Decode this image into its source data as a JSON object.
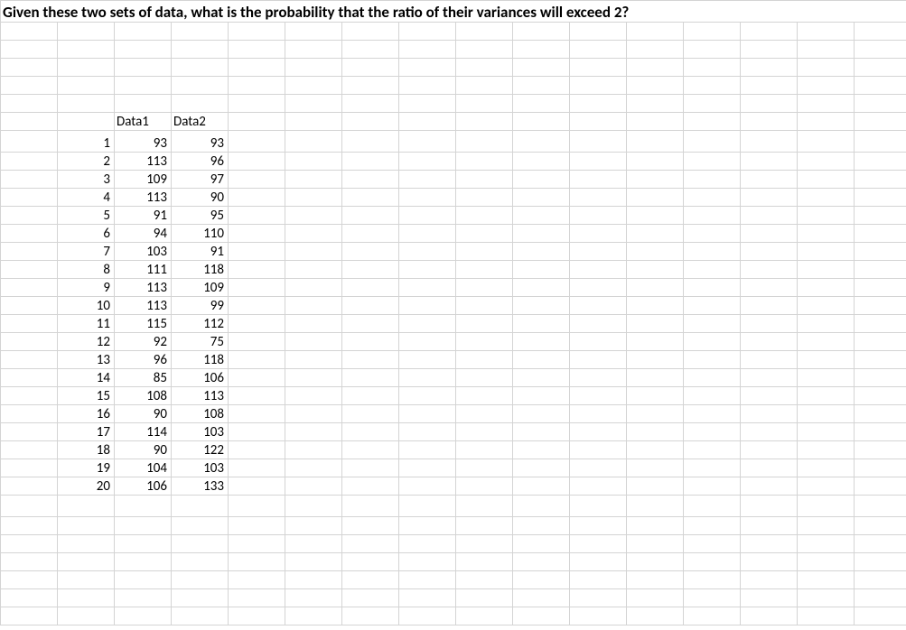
{
  "title": "Given these two sets of data, what is the probability that the ratio of their variances will exceed 2?",
  "headers": {
    "index": "",
    "data1": "Data1",
    "data2": "Data2"
  },
  "rows": [
    {
      "idx": "1",
      "d1": "93",
      "d2": "93"
    },
    {
      "idx": "2",
      "d1": "113",
      "d2": "96"
    },
    {
      "idx": "3",
      "d1": "109",
      "d2": "97"
    },
    {
      "idx": "4",
      "d1": "113",
      "d2": "90"
    },
    {
      "idx": "5",
      "d1": "91",
      "d2": "95"
    },
    {
      "idx": "6",
      "d1": "94",
      "d2": "110"
    },
    {
      "idx": "7",
      "d1": "103",
      "d2": "91"
    },
    {
      "idx": "8",
      "d1": "111",
      "d2": "118"
    },
    {
      "idx": "9",
      "d1": "113",
      "d2": "109"
    },
    {
      "idx": "10",
      "d1": "113",
      "d2": "99"
    },
    {
      "idx": "11",
      "d1": "115",
      "d2": "112"
    },
    {
      "idx": "12",
      "d1": "92",
      "d2": "75"
    },
    {
      "idx": "13",
      "d1": "96",
      "d2": "118"
    },
    {
      "idx": "14",
      "d1": "85",
      "d2": "106"
    },
    {
      "idx": "15",
      "d1": "108",
      "d2": "113"
    },
    {
      "idx": "16",
      "d1": "90",
      "d2": "108"
    },
    {
      "idx": "17",
      "d1": "114",
      "d2": "103"
    },
    {
      "idx": "18",
      "d1": "90",
      "d2": "122"
    },
    {
      "idx": "19",
      "d1": "104",
      "d2": "103"
    },
    {
      "idx": "20",
      "d1": "106",
      "d2": "133"
    }
  ]
}
